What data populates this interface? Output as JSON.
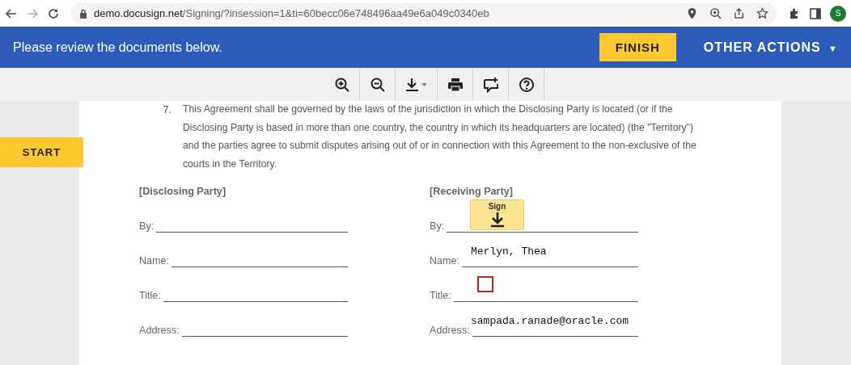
{
  "browser": {
    "url_host": "demo.docusign.net",
    "url_path": "/Signing/?insession=1&ti=60becc06e748496aa49e6a049c0340eb",
    "profile_initial": "S"
  },
  "header": {
    "message": "Please review the documents below.",
    "finish_button": "FINISH",
    "other_actions": "OTHER ACTIONS",
    "other_actions_caret": "▼"
  },
  "start_tab": "START",
  "clause": {
    "number": "7.",
    "text": "This Agreement shall be governed by the laws of the jurisdiction in which the Disclosing Party is located (or if the Disclosing Party is based in more than one country, the country in which its headquarters are located) (the \"Territory\") and the parties agree to submit disputes arising out of or in connection with this Agreement to the non-exclusive of the courts in the Territory."
  },
  "parties": [
    {
      "heading": "[Disclosing Party]",
      "fields": [
        {
          "label": "By:"
        },
        {
          "label": "Name:"
        },
        {
          "label": "Title:"
        },
        {
          "label": "Address:"
        }
      ]
    },
    {
      "heading": "[Receiving Party]",
      "fields": [
        {
          "label": "By:",
          "tag": {
            "kind": "sign",
            "label": "Sign"
          }
        },
        {
          "label": "Name:",
          "value": "Merlyn, Thea"
        },
        {
          "label": "Title:",
          "tag": {
            "kind": "checkbox",
            "checked": false
          }
        },
        {
          "label": "Address:",
          "value": "sampada.ranade@oracle.com"
        }
      ]
    }
  ]
}
